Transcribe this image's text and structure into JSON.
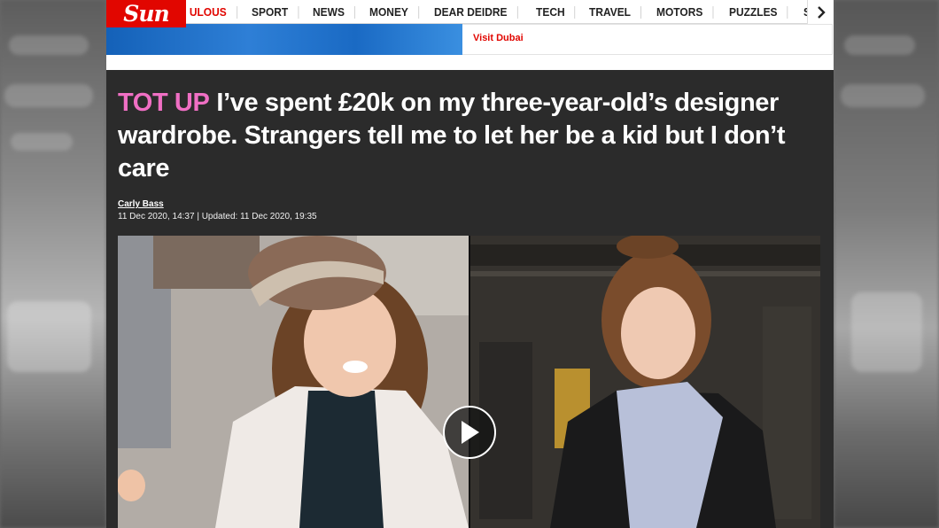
{
  "nav": {
    "logo": "Sun",
    "items": [
      "ULOUS",
      "SPORT",
      "NEWS",
      "MONEY",
      "DEAR DEIDRE",
      "TECH",
      "TRAVEL",
      "MOTORS",
      "PUZZLES",
      "SUN BINGO",
      "S"
    ],
    "next_icon": "chevron-right-icon"
  },
  "ad": {
    "link_text": "Visit Dubai"
  },
  "article": {
    "kicker": "TOT UP",
    "headline": "I’ve spent £20k on my three-year-old’s designer wardrobe. Strangers tell me to let her be a kid but I don’t care",
    "author": "Carly Bass",
    "dates": "11 Dec 2020, 14:37 | Updated: 11 Dec 2020, 19:35"
  },
  "media": {
    "play_icon": "play-icon"
  },
  "colors": {
    "brand_red": "#e10600",
    "kicker_pink": "#f06fc4",
    "article_bg": "#2b2b2b"
  }
}
